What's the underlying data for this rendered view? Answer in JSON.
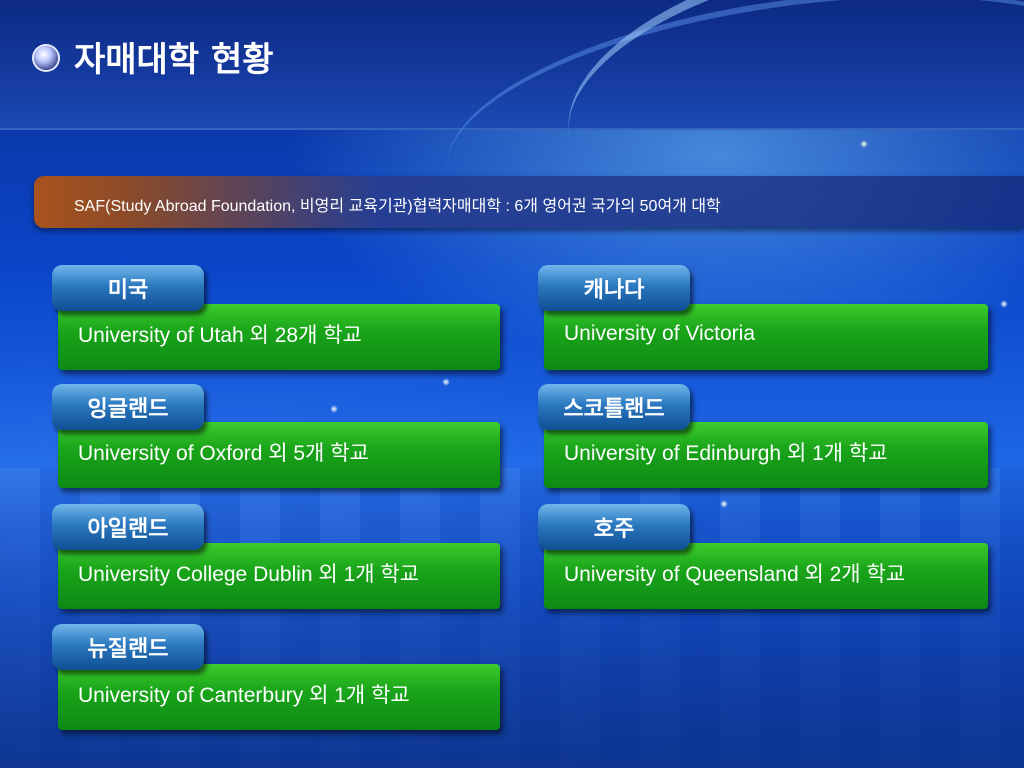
{
  "slide": {
    "title": "자매대학 현황",
    "subtitle": "SAF(Study Abroad Foundation, 비영리 교육기관)협력자매대학 : 6개 영어권 국가의 50여개 대학"
  },
  "colors": {
    "background": "#0b46c9",
    "country_tab": "#2b78c0",
    "university_box": "#1aa51a",
    "banner": "#a9531d"
  },
  "icons": [
    "bullet-icon"
  ],
  "entries": [
    {
      "country": "미국",
      "university": "University of Utah 외 28개 학교"
    },
    {
      "country": "캐나다",
      "university": "University of Victoria"
    },
    {
      "country": "잉글랜드",
      "university": "University of Oxford 외 5개 학교"
    },
    {
      "country": "스코틀랜드",
      "university": "University of Edinburgh 외 1개 학교"
    },
    {
      "country": "아일랜드",
      "university": "University College Dublin 외 1개 학교"
    },
    {
      "country": "호주",
      "university": "University of Queensland 외 2개 학교"
    },
    {
      "country": "뉴질랜드",
      "university": "University of Canterbury 외 1개 학교"
    }
  ]
}
